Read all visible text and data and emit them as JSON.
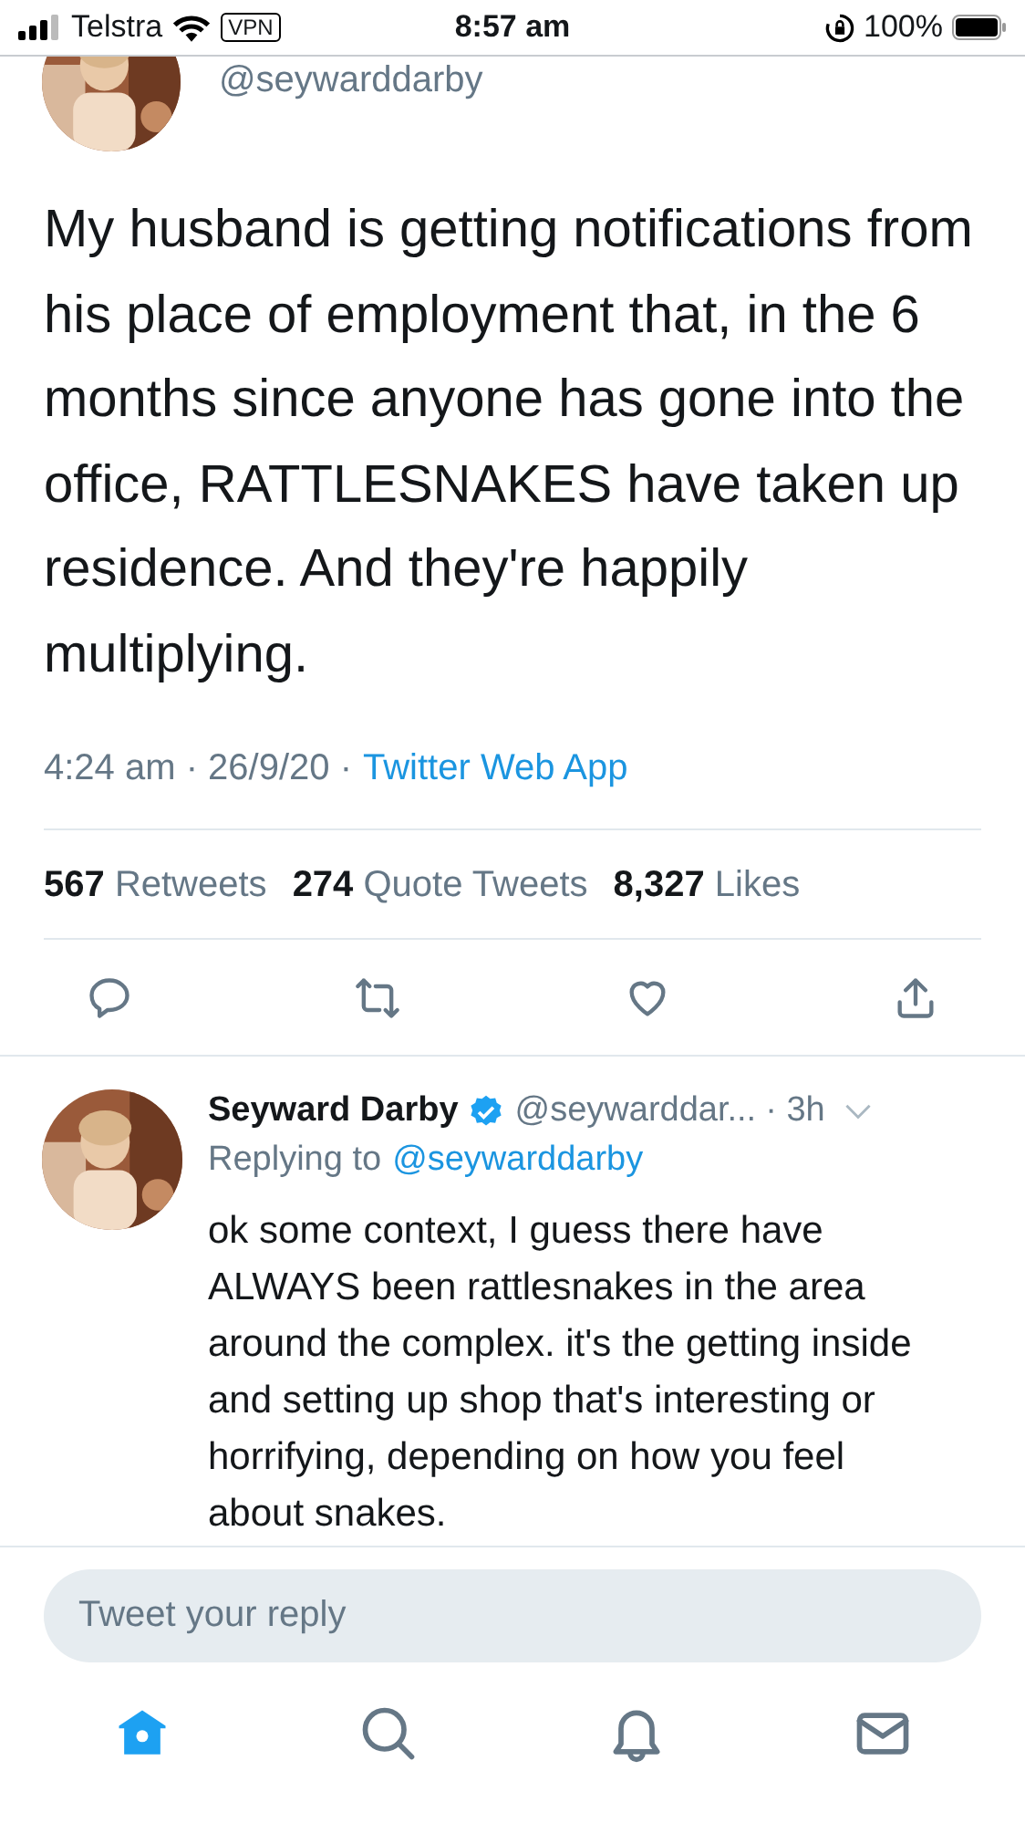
{
  "status_bar": {
    "carrier": "Telstra",
    "vpn": "VPN",
    "time": "8:57 am",
    "battery": "100%"
  },
  "tweet": {
    "handle": "@seywarddarby",
    "text": "My husband is getting notifications from his place of employment that, in the 6 months since anyone has gone into the office, RATTLESNAKES have taken up residence. And they're happily multiplying.",
    "timestamp": "4:24 am · 26/9/20 ·",
    "source": "Twitter Web App",
    "stats": [
      {
        "count": "567",
        "label": "Retweets"
      },
      {
        "count": "274",
        "label": "Quote Tweets"
      },
      {
        "count": "8,327",
        "label": "Likes"
      }
    ],
    "actions": [
      {
        "kind": "reply"
      },
      {
        "kind": "retweet"
      },
      {
        "kind": "like"
      },
      {
        "kind": "share"
      }
    ]
  },
  "reply": {
    "name": "Seyward Darby",
    "verified": true,
    "handle": "@seywarddar...",
    "age": "· 3h",
    "replying_label": "Replying to",
    "replying_to": "@seywarddarby",
    "text": "ok some context, I guess there have ALWAYS been rattlesnakes in the area around the complex. it's the getting inside and setting up shop that's interesting or horrifying, depending on how you feel about snakes."
  },
  "composer": {
    "placeholder": "Tweet your reply"
  },
  "tabs": [
    {
      "kind": "home",
      "selected": true
    },
    {
      "kind": "search",
      "selected": false
    },
    {
      "kind": "notifications",
      "selected": false
    },
    {
      "kind": "messages",
      "selected": false
    }
  ]
}
